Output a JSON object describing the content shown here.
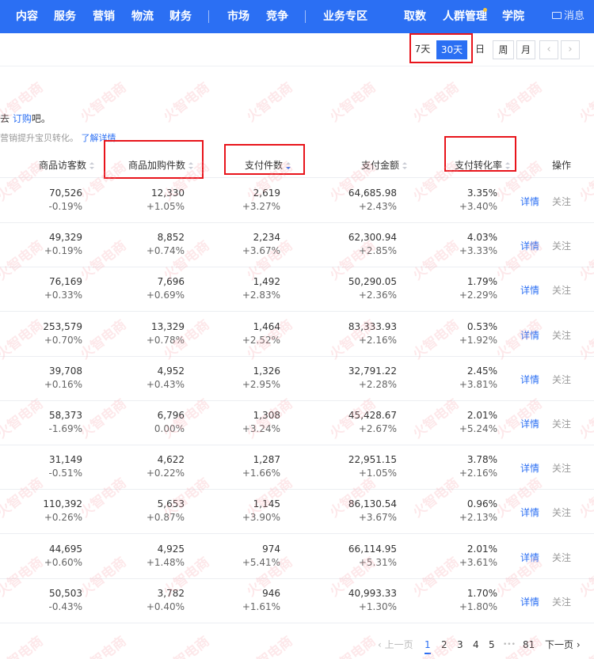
{
  "nav": {
    "items": [
      "内容",
      "服务",
      "营销",
      "物流",
      "财务",
      "市场",
      "竞争",
      "业务专区",
      "取数",
      "人群管理",
      "学院"
    ],
    "message": "消息"
  },
  "time_filter": {
    "options": [
      "7天",
      "30天",
      "日",
      "周",
      "月"
    ],
    "selected": "30天",
    "prev": "‹",
    "next": "›"
  },
  "hints": {
    "line1_prefix": "去 ",
    "line1_link": "订购",
    "line1_suffix": "吧。",
    "line2_text": "营销提升宝贝转化。",
    "line2_link": "了解详情"
  },
  "table": {
    "columns": [
      "商品访客数",
      "商品加购件数",
      "支付件数",
      "支付金额",
      "支付转化率",
      "操作"
    ],
    "sorted_column": "支付件数",
    "rows": [
      {
        "visitors": "70,526",
        "visitors_change": "-0.19%",
        "cart": "12,330",
        "cart_change": "+1.05%",
        "units": "2,619",
        "units_change": "+3.27%",
        "amount": "64,685.98",
        "amount_change": "+2.43%",
        "rate": "3.35%",
        "rate_change": "+3.40%"
      },
      {
        "visitors": "49,329",
        "visitors_change": "+0.19%",
        "cart": "8,852",
        "cart_change": "+0.74%",
        "units": "2,234",
        "units_change": "+3.67%",
        "amount": "62,300.94",
        "amount_change": "+2.85%",
        "rate": "4.03%",
        "rate_change": "+3.33%"
      },
      {
        "visitors": "76,169",
        "visitors_change": "+0.33%",
        "cart": "7,696",
        "cart_change": "+0.69%",
        "units": "1,492",
        "units_change": "+2.83%",
        "amount": "50,290.05",
        "amount_change": "+2.36%",
        "rate": "1.79%",
        "rate_change": "+2.29%"
      },
      {
        "visitors": "253,579",
        "visitors_change": "+0.70%",
        "cart": "13,329",
        "cart_change": "+0.78%",
        "units": "1,464",
        "units_change": "+2.52%",
        "amount": "83,333.93",
        "amount_change": "+2.16%",
        "rate": "0.53%",
        "rate_change": "+1.92%"
      },
      {
        "visitors": "39,708",
        "visitors_change": "+0.16%",
        "cart": "4,952",
        "cart_change": "+0.43%",
        "units": "1,326",
        "units_change": "+2.95%",
        "amount": "32,791.22",
        "amount_change": "+2.28%",
        "rate": "2.45%",
        "rate_change": "+3.81%"
      },
      {
        "visitors": "58,373",
        "visitors_change": "-1.69%",
        "cart": "6,796",
        "cart_change": "0.00%",
        "units": "1,308",
        "units_change": "+3.24%",
        "amount": "45,428.67",
        "amount_change": "+2.67%",
        "rate": "2.01%",
        "rate_change": "+5.24%"
      },
      {
        "visitors": "31,149",
        "visitors_change": "-0.51%",
        "cart": "4,622",
        "cart_change": "+0.22%",
        "units": "1,287",
        "units_change": "+1.66%",
        "amount": "22,951.15",
        "amount_change": "+1.05%",
        "rate": "3.78%",
        "rate_change": "+2.16%"
      },
      {
        "visitors": "110,392",
        "visitors_change": "+0.26%",
        "cart": "5,653",
        "cart_change": "+0.87%",
        "units": "1,145",
        "units_change": "+3.90%",
        "amount": "86,130.54",
        "amount_change": "+3.67%",
        "rate": "0.96%",
        "rate_change": "+2.13%"
      },
      {
        "visitors": "44,695",
        "visitors_change": "+0.60%",
        "cart": "4,925",
        "cart_change": "+1.48%",
        "units": "974",
        "units_change": "+5.41%",
        "amount": "66,114.95",
        "amount_change": "+5.31%",
        "rate": "2.01%",
        "rate_change": "+3.61%"
      },
      {
        "visitors": "50,503",
        "visitors_change": "-0.43%",
        "cart": "3,782",
        "cart_change": "+0.40%",
        "units": "946",
        "units_change": "+1.61%",
        "amount": "40,993.33",
        "amount_change": "+1.30%",
        "rate": "1.70%",
        "rate_change": "+1.80%"
      }
    ],
    "action_detail": "详情",
    "action_follow": "关注"
  },
  "pagination": {
    "prev": "‹ 上一页",
    "pages": [
      "1",
      "2",
      "3",
      "4",
      "5"
    ],
    "ellipsis": "•••",
    "last_page": "81",
    "next": "下一页 ›",
    "current": "1"
  },
  "watermark": {
    "text": "火智电商"
  },
  "colors": {
    "primary": "#2b6ff3",
    "annotation": "#e8141b",
    "watermark": "#f596a0"
  }
}
